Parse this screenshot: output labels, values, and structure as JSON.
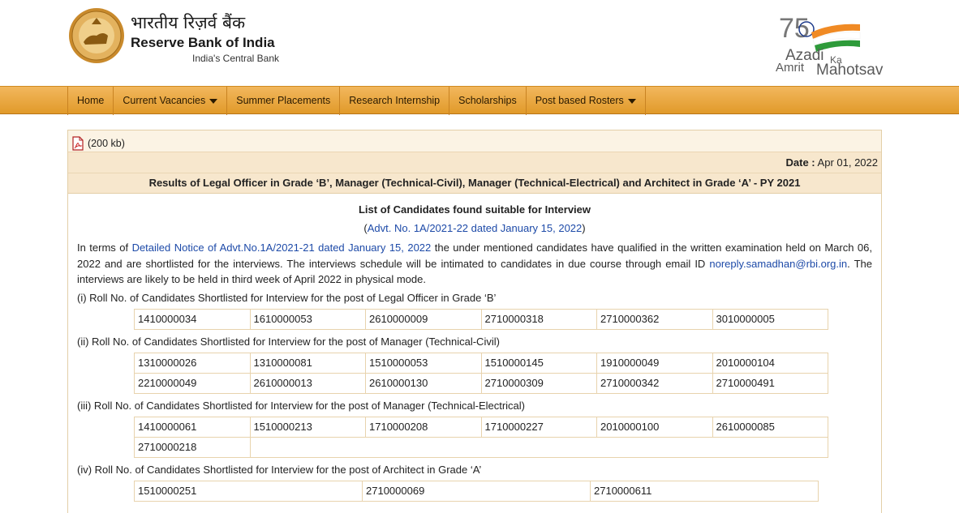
{
  "header": {
    "hindi_name": "भारतीय रिज़र्व बैंक",
    "english_name": "Reserve Bank of India",
    "tagline": "India's Central Bank",
    "logo_icon": "rbi-seal-icon",
    "azadi": {
      "number": "75",
      "line1": "Azadi",
      "ka": "Ka",
      "line2": "Amrit",
      "line3": "Mahotsav"
    }
  },
  "nav": {
    "items": [
      {
        "label": "Home",
        "dropdown": false
      },
      {
        "label": "Current Vacancies",
        "dropdown": true
      },
      {
        "label": "Summer Placements",
        "dropdown": false
      },
      {
        "label": "Research Internship",
        "dropdown": false
      },
      {
        "label": "Scholarships",
        "dropdown": false
      },
      {
        "label": "Post based Rosters",
        "dropdown": true
      }
    ]
  },
  "pdf": {
    "size": "(200 kb)",
    "icon": "pdf-icon"
  },
  "date": {
    "label": "Date :",
    "value": "Apr 01, 2022"
  },
  "title": "Results of Legal Officer in Grade ‘B’, Manager (Technical-Civil), Manager (Technical-Electrical) and Architect in Grade ‘A’ - PY 2021",
  "list_title": "List of Candidates found suitable for Interview",
  "advt": {
    "open": "(",
    "link": "Advt. No. 1A/2021-22 dated January 15, 2022",
    "close": ")"
  },
  "para": {
    "pre": "In terms of ",
    "link": "Detailed Notice of Advt.No.1A/2021-21 dated January 15, 2022",
    "mid": " the under mentioned candidates have qualified in the written examination held on March 06, 2022 and are shortlisted for the interviews. The interviews schedule will be intimated to candidates in due course through email ID ",
    "email": "noreply.samadhan@rbi.org.in",
    "post": ". The interviews are likely to be held in third week of April 2022 in physical mode."
  },
  "sections": [
    {
      "title": "(i) Roll No. of Candidates Shortlisted for Interview for the post of Legal Officer in Grade ‘B’",
      "rows": [
        [
          "1410000034",
          "1610000053",
          "2610000009",
          "2710000318",
          "2710000362",
          "3010000005"
        ]
      ]
    },
    {
      "title": "(ii) Roll No. of Candidates Shortlisted for Interview for the post of Manager (Technical-Civil)",
      "rows": [
        [
          "1310000026",
          "1310000081",
          "1510000053",
          "1510000145",
          "1910000049",
          "2010000104"
        ],
        [
          "2210000049",
          "2610000013",
          "2610000130",
          "2710000309",
          "2710000342",
          "2710000491"
        ]
      ]
    },
    {
      "title": "(iii) Roll No. of Candidates Shortlisted for Interview for the post of Manager (Technical-Electrical)",
      "rows": [
        [
          "1410000061",
          "1510000213",
          "1710000208",
          "1710000227",
          "2010000100",
          "2610000085"
        ],
        [
          "2710000218"
        ]
      ]
    },
    {
      "title": "(iv) Roll No. of Candidates Shortlisted for Interview for the post of Architect in Grade ‘A’",
      "rows": [
        [
          "1510000251",
          "2710000069",
          "2710000611"
        ]
      ]
    }
  ]
}
